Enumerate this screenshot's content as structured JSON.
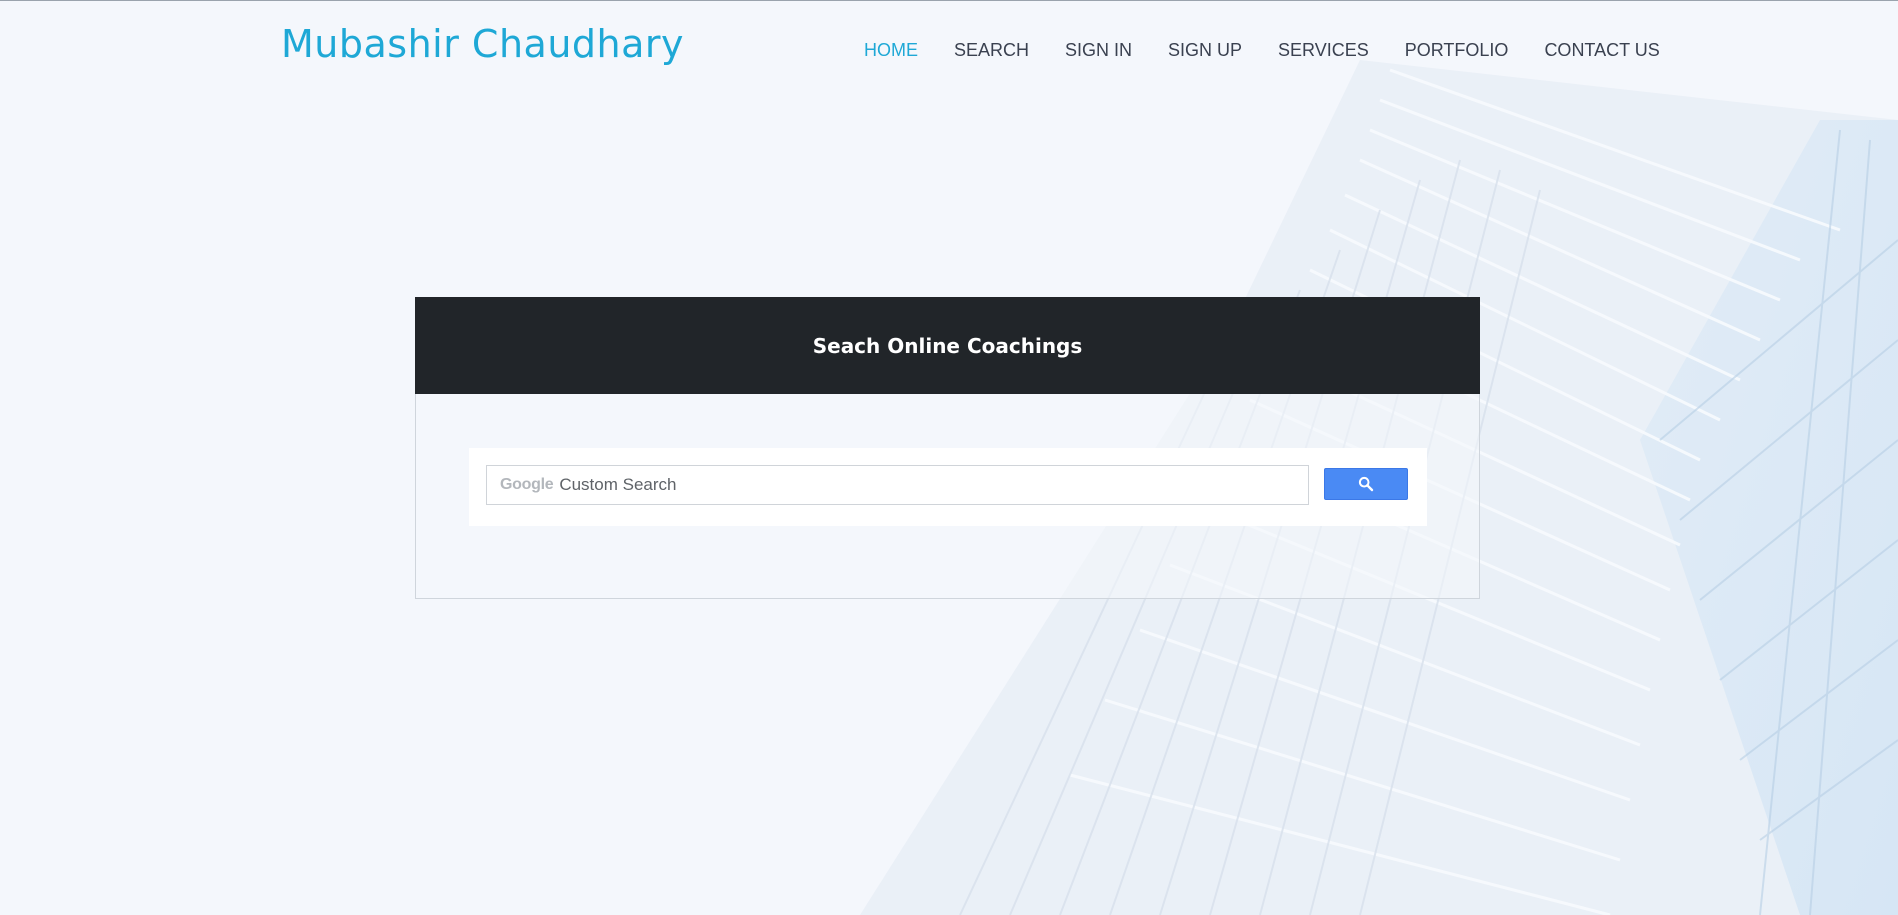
{
  "site": {
    "brand": "Mubashir Chaudhary"
  },
  "nav": {
    "items": [
      {
        "label": "HOME",
        "active": true
      },
      {
        "label": "SEARCH",
        "active": false
      },
      {
        "label": "SIGN IN",
        "active": false
      },
      {
        "label": "SIGN UP",
        "active": false
      },
      {
        "label": "SERVICES",
        "active": false
      },
      {
        "label": "PORTFOLIO",
        "active": false
      },
      {
        "label": "CONTACT US",
        "active": false
      }
    ]
  },
  "panel": {
    "title": "Seach Online Coachings"
  },
  "search": {
    "brand_text": "Google",
    "placeholder": "Custom Search",
    "value": "",
    "button_icon": "search-icon"
  },
  "colors": {
    "accent": "#1ea8d6",
    "nav_text": "#3a4150",
    "panel_header": "#212529",
    "search_button": "#4a8af4",
    "page_background": "#f4f7fc"
  }
}
